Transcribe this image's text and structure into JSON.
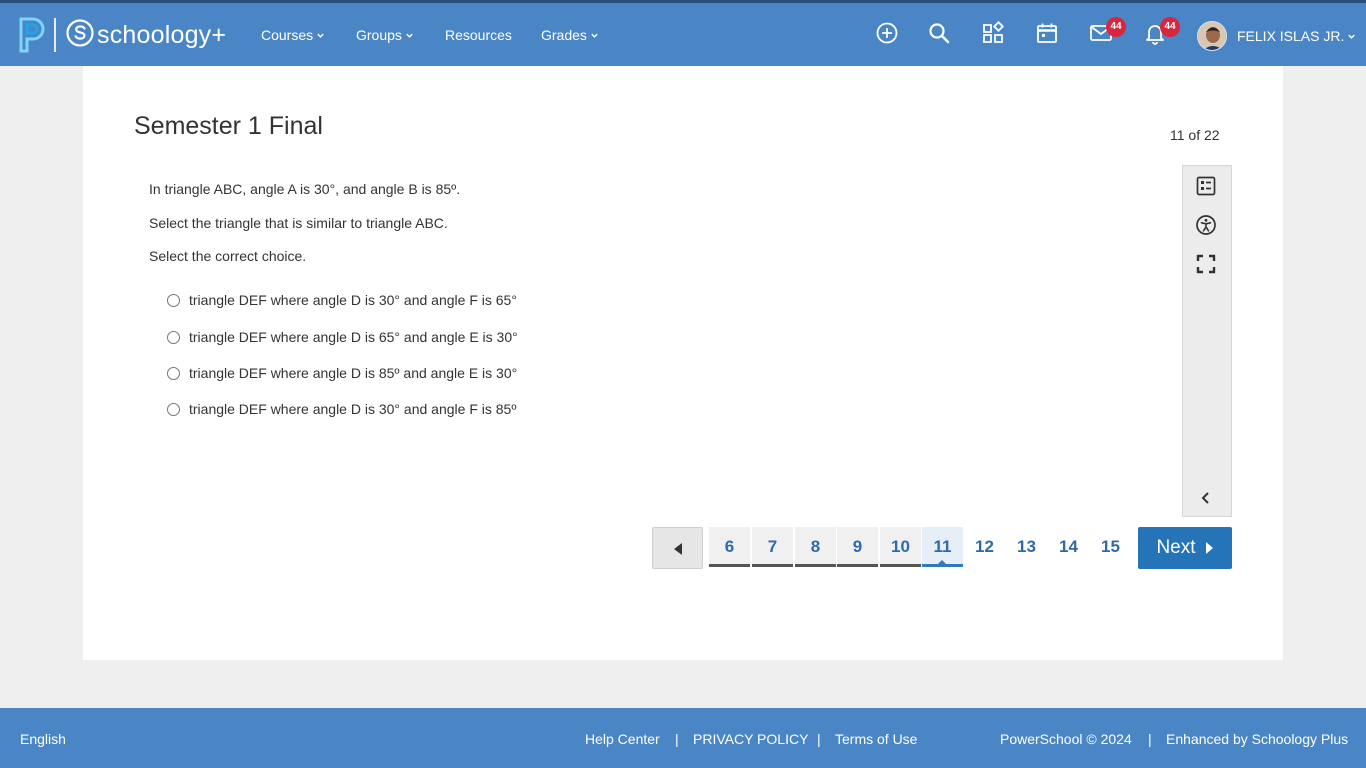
{
  "header": {
    "logo_text": "schoology+",
    "nav": [
      {
        "label": "Courses",
        "has_dropdown": true
      },
      {
        "label": "Groups",
        "has_dropdown": true
      },
      {
        "label": "Resources",
        "has_dropdown": false
      },
      {
        "label": "Grades",
        "has_dropdown": true
      }
    ],
    "icons": [
      "add-icon",
      "search-icon",
      "apps-icon",
      "calendar-icon",
      "mail-icon",
      "bell-icon"
    ],
    "mail_badge": "44",
    "notifications_badge": "44",
    "user_name": "FELIX ISLAS JR."
  },
  "assessment": {
    "title": "Semester 1 Final",
    "counter": "11 of 22",
    "question_lines": [
      "In triangle ABC, angle A is 30°, and angle B is 85º.",
      "Select the triangle that is similar to triangle ABC.",
      "Select the correct choice."
    ],
    "choices": [
      "triangle DEF where angle D is 30° and angle F is 65°",
      "triangle DEF where angle D is 65° and angle E is 30°",
      "triangle DEF where angle D is 85º and angle E is 30°",
      "triangle DEF where angle D is 30° and angle F is 85º"
    ]
  },
  "tools": [
    "checklist-icon",
    "accessibility-icon",
    "fullscreen-icon",
    "collapse-icon"
  ],
  "pagination": {
    "pages": [
      "6",
      "7",
      "8",
      "9",
      "10",
      "11",
      "12",
      "13",
      "14",
      "15"
    ],
    "answered": [
      "6",
      "7",
      "8",
      "9",
      "10"
    ],
    "current": "11",
    "next_label": "Next"
  },
  "footer": {
    "language": "English",
    "links": [
      "Help Center",
      "PRIVACY POLICY",
      "Terms of Use"
    ],
    "separator": "|",
    "copyright": "PowerSchool © 2024",
    "enhanced": "Enhanced by Schoology Plus"
  },
  "colors": {
    "header_bg": "#4a86c5",
    "accent": "#2574b8",
    "badge": "#d7263d"
  }
}
